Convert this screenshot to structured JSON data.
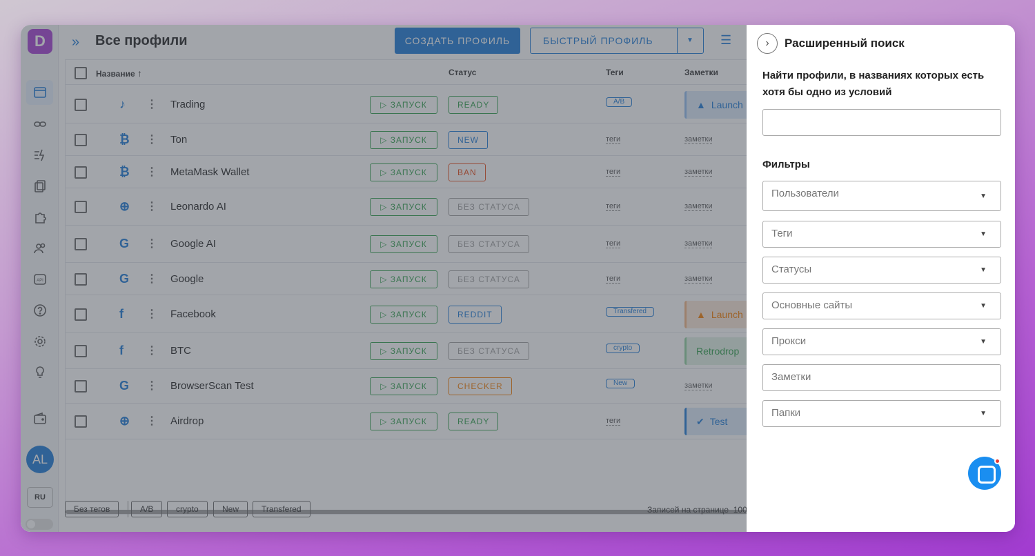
{
  "app": {
    "logo_letter": "D"
  },
  "header": {
    "title": "Все профили",
    "create_button": "СОЗДАТЬ ПРОФИЛЬ",
    "quick_button": "БЫСТРЫЙ ПРОФИЛЬ"
  },
  "table": {
    "columns": {
      "name": "Название",
      "status": "Статус",
      "tags": "Теги",
      "notes": "Заметки"
    },
    "launch_label": "ЗАПУСК",
    "rows": [
      {
        "name": "Trading",
        "site_icon": "tiktok-icon",
        "site_glyph": "♪",
        "status": "READY",
        "status_color": "#2e9e4b",
        "tags": "A/B",
        "tag_type": "chip",
        "note": "Launch",
        "note_type": "warning"
      },
      {
        "name": "Ton",
        "site_icon": "bitcoin-icon",
        "site_glyph": "₿",
        "status": "NEW",
        "status_color": "#1a79d6",
        "tags": "теги",
        "tag_type": "link",
        "note": "заметки",
        "note_type": "link"
      },
      {
        "name": "MetaMask Wallet",
        "site_icon": "bitcoin-icon",
        "site_glyph": "₿",
        "status": "BAN",
        "status_color": "#e64a19",
        "tags": "теги",
        "tag_type": "link",
        "note": "заметки",
        "note_type": "link"
      },
      {
        "name": "Leonardo AI",
        "site_icon": "globe-icon",
        "site_glyph": "⊕",
        "status": "БЕЗ СТАТУСА",
        "status_color": "#9e9e9e",
        "tags": "теги",
        "tag_type": "link",
        "note": "заметки",
        "note_type": "link"
      },
      {
        "name": "Google AI",
        "site_icon": "google-icon",
        "site_glyph": "G",
        "status": "БЕЗ СТАТУСА",
        "status_color": "#9e9e9e",
        "tags": "теги",
        "tag_type": "link",
        "note": "заметки",
        "note_type": "link"
      },
      {
        "name": "Google",
        "site_icon": "google-icon",
        "site_glyph": "G",
        "status": "БЕЗ СТАТУСА",
        "status_color": "#9e9e9e",
        "tags": "теги",
        "tag_type": "link",
        "note": "заметки",
        "note_type": "link"
      },
      {
        "name": "Facebook",
        "site_icon": "facebook-icon",
        "site_glyph": "f",
        "status": "REDDIT",
        "status_color": "#1a79d6",
        "tags": "Transfered",
        "tag_type": "chip",
        "note": "Launch",
        "note_type": "warning-orange"
      },
      {
        "name": "BTC",
        "site_icon": "facebook-icon",
        "site_glyph": "f",
        "status": "БЕЗ СТАТУСА",
        "status_color": "#9e9e9e",
        "tags": "crypto",
        "tag_type": "chip",
        "note": "Retrodrop",
        "note_type": "success"
      },
      {
        "name": "BrowserScan Test",
        "site_icon": "google-icon",
        "site_glyph": "G",
        "status": "CHECKER",
        "status_color": "#f57c00",
        "tags": "New",
        "tag_type": "chip",
        "note": "заметки",
        "note_type": "link"
      },
      {
        "name": "Airdrop",
        "site_icon": "globe-icon",
        "site_glyph": "⊕",
        "status": "READY",
        "status_color": "#2e9e4b",
        "tags": "теги",
        "tag_type": "link",
        "note": "Test",
        "note_type": "info"
      }
    ]
  },
  "footer": {
    "tag_chips": [
      "Без тегов",
      "A/B",
      "crypto",
      "New",
      "Transfered"
    ],
    "per_page_label": "Записей на странице",
    "per_page_value": "100"
  },
  "sidebar": {
    "avatar_initials": "AL",
    "language": "RU"
  },
  "panel": {
    "title": "Расширенный поиск",
    "description": "Найти профили, в названиях которых есть хотя бы одно из условий",
    "filters_label": "Фильтры",
    "selects": [
      {
        "placeholder": "Пользователи",
        "has_arrow": true
      },
      {
        "placeholder": "Теги",
        "has_arrow": true
      },
      {
        "placeholder": "Статусы",
        "has_arrow": true
      },
      {
        "placeholder": "Основные сайты",
        "has_arrow": true
      },
      {
        "placeholder": "Прокси",
        "has_arrow": true
      },
      {
        "placeholder": "Заметки",
        "has_arrow": false
      },
      {
        "placeholder": "Папки",
        "has_arrow": true
      }
    ]
  }
}
